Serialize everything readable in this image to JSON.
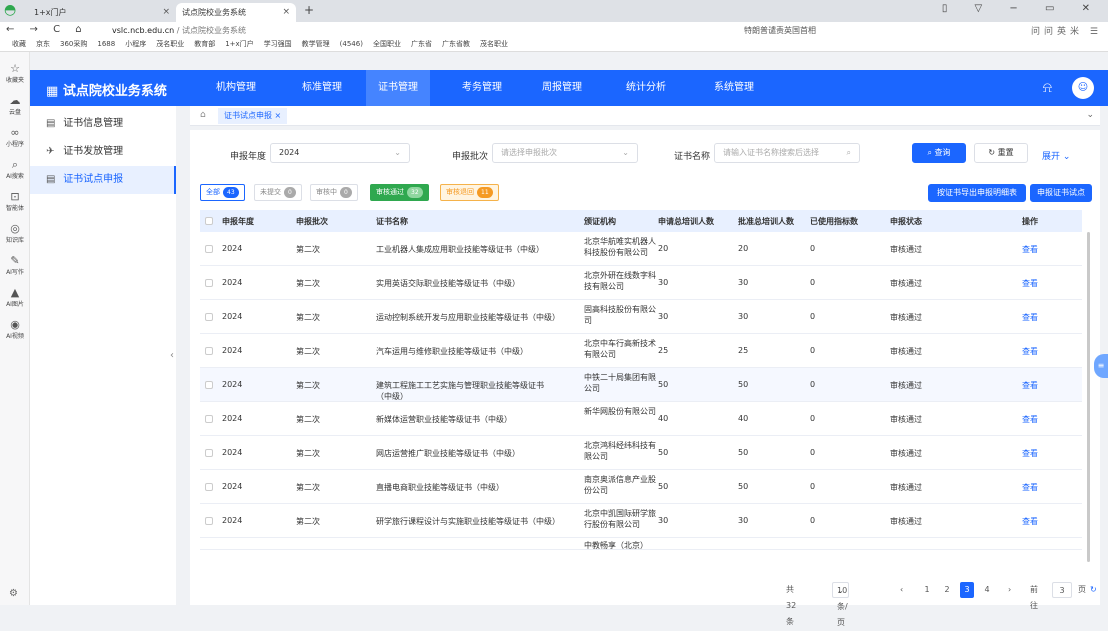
{
  "browser": {
    "tabs": [
      {
        "title": "1+x门户"
      },
      {
        "title": "试点院校业务系统"
      }
    ],
    "new_tab": "+",
    "url_host": "vslc.ncb.edu.cn",
    "url_title": " / 试点院校业务系统",
    "search_suggestion": "特朗普谴责英国首相",
    "tools": "问问英米"
  },
  "bookmarks": [
    "收藏",
    "京东",
    "360采购",
    "1688",
    "小程序",
    "茂名职业",
    "教育部",
    "1+x门户",
    "学习强国",
    "教学管理",
    "(4546)",
    "全国职业",
    "广东省",
    "广东省教",
    "茂名职业"
  ],
  "left_rail": [
    {
      "label": "收藏夹",
      "icon": "☆"
    },
    {
      "label": "云盘",
      "icon": "☁"
    },
    {
      "label": "小程序",
      "icon": "∞"
    },
    {
      "label": "AI搜索",
      "icon": "⌕"
    },
    {
      "label": "智能体",
      "icon": "⊡"
    },
    {
      "label": "知识库",
      "icon": "◎"
    },
    {
      "label": "AI写作",
      "icon": "✎"
    },
    {
      "label": "AI图片",
      "icon": "▲"
    },
    {
      "label": "AI视频",
      "icon": "◉"
    }
  ],
  "header": {
    "logo": "试点院校业务系统",
    "menu": [
      "机构管理",
      "标准管理",
      "证书管理",
      "考务管理",
      "周报管理",
      "统计分析",
      "系统管理"
    ],
    "active_menu": "证书管理"
  },
  "sidebar": {
    "items": [
      {
        "label": "证书信息管理",
        "icon": "▤"
      },
      {
        "label": "证书发放管理",
        "icon": "✈"
      },
      {
        "label": "证书试点申报",
        "icon": "▤",
        "active": true
      }
    ]
  },
  "page_tab": {
    "label": "证书试点申报",
    "close": "×"
  },
  "filters": {
    "year_label": "申报年度",
    "year_value": "2024",
    "batch_label": "申报批次",
    "batch_placeholder": "请选择申报批次",
    "cert_label": "证书名称",
    "cert_placeholder": "请输入证书名称搜索后选择",
    "search_btn": "查询",
    "reset_btn": "重置",
    "expand": "展开"
  },
  "status_chips": [
    {
      "label": "全部",
      "count": "43"
    },
    {
      "label": "未提交",
      "count": "0"
    },
    {
      "label": "审核中",
      "count": "0"
    },
    {
      "label": "审核通过",
      "count": "32"
    },
    {
      "label": "审核退回",
      "count": "11"
    }
  ],
  "actions": {
    "export": "按证书导出申报明细表",
    "apply": "申报证书试点"
  },
  "table": {
    "headers": [
      "申报年度",
      "申报批次",
      "证书名称",
      "颁证机构",
      "申请总培训人数",
      "批准总培训人数",
      "已使用指标数",
      "申报状态",
      "操作"
    ],
    "rows": [
      [
        "2024",
        "第二次",
        "工业机器人集成应用职业技能等级证书（中级）",
        "北京华航唯实机器人科技股份有限公司",
        "20",
        "20",
        "0",
        "审核通过",
        "查看"
      ],
      [
        "2024",
        "第二次",
        "实用英语交际职业技能等级证书（中级）",
        "北京外研在线数字科技有限公司",
        "30",
        "30",
        "0",
        "审核通过",
        "查看"
      ],
      [
        "2024",
        "第二次",
        "运动控制系统开发与应用职业技能等级证书（中级）",
        "固高科技股份有限公司",
        "30",
        "30",
        "0",
        "审核通过",
        "查看"
      ],
      [
        "2024",
        "第二次",
        "汽车运用与维修职业技能等级证书（中级）",
        "北京中车行高新技术有限公司",
        "25",
        "25",
        "0",
        "审核通过",
        "查看"
      ],
      [
        "2024",
        "第二次",
        "建筑工程施工工艺实施与管理职业技能等级证书（中级）",
        "中铁二十局集团有限公司",
        "50",
        "50",
        "0",
        "审核通过",
        "查看"
      ],
      [
        "2024",
        "第二次",
        "新媒体运营职业技能等级证书（中级）",
        "新华网股份有限公司",
        "40",
        "40",
        "0",
        "审核通过",
        "查看"
      ],
      [
        "2024",
        "第二次",
        "网店运营推广职业技能等级证书（中级）",
        "北京鸿科经纬科技有限公司",
        "50",
        "50",
        "0",
        "审核通过",
        "查看"
      ],
      [
        "2024",
        "第二次",
        "直播电商职业技能等级证书（中级）",
        "南京奥派信息产业股份公司",
        "50",
        "50",
        "0",
        "审核通过",
        "查看"
      ],
      [
        "2024",
        "第二次",
        "研学旅行课程设计与实施职业技能等级证书（中级）",
        "北京中凯国际研学旅行股份有限公司",
        "30",
        "30",
        "0",
        "审核通过",
        "查看"
      ]
    ],
    "partial_org": "中教畅享（北京）"
  },
  "pager": {
    "total": "共 32 条",
    "size": "10条/页",
    "pages": [
      "1",
      "2",
      "3",
      "4"
    ],
    "current": "3",
    "goto": "前往",
    "goto_value": "3",
    "page_unit": "页"
  },
  "colors": {
    "primary": "#1b66ff",
    "success": "#2fa84f",
    "warning": "#f59a23"
  }
}
